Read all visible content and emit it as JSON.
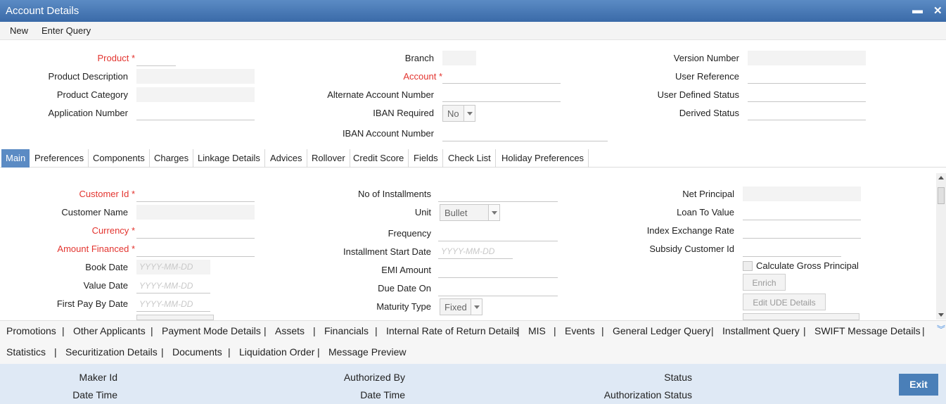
{
  "window": {
    "title": "Account Details",
    "minimize": "▬",
    "close": "✕"
  },
  "menu": {
    "new": "New",
    "enter_query": "Enter Query"
  },
  "header": {
    "product": "Product",
    "product_description": "Product Description",
    "product_category": "Product Category",
    "application_number": "Application Number",
    "branch": "Branch",
    "account": "Account",
    "alternate_account_number": "Alternate Account Number",
    "iban_required": "IBAN Required",
    "iban_required_value": "No",
    "iban_account_number": "IBAN Account Number",
    "version_number": "Version Number",
    "user_reference": "User Reference",
    "user_defined_status": "User Defined Status",
    "derived_status": "Derived Status"
  },
  "required_mark": "*",
  "tabs": [
    "Main",
    "Preferences",
    "Components",
    "Charges",
    "Linkage Details",
    "Advices",
    "Rollover",
    "Credit Score",
    "Fields",
    "Check List",
    "Holiday Preferences"
  ],
  "main": {
    "customer_id": "Customer Id",
    "customer_name": "Customer Name",
    "currency": "Currency",
    "amount_financed": "Amount Financed",
    "book_date": "Book Date",
    "value_date": "Value Date",
    "first_pay_by_date": "First Pay By Date",
    "date_placeholder": "YYYY-MM-DD",
    "no_of_installments": "No of Installments",
    "unit": "Unit",
    "unit_value": "Bullet",
    "frequency": "Frequency",
    "installment_start_date": "Installment Start Date",
    "emi_amount": "EMI Amount",
    "due_date_on": "Due Date On",
    "maturity_type": "Maturity Type",
    "maturity_type_value": "Fixed",
    "net_principal": "Net Principal",
    "loan_to_value": "Loan To Value",
    "index_exchange_rate": "Index Exchange Rate",
    "subsidy_customer_id": "Subsidy Customer Id",
    "calculate_gross_principal": "Calculate Gross Principal",
    "enrich": "Enrich",
    "edit_ude_details": "Edit UDE Details"
  },
  "subsystems": {
    "row1": [
      "Promotions",
      "Other Applicants",
      "Payment Mode Details",
      "Assets",
      "Financials",
      "Internal Rate of Return Details",
      "MIS",
      "Events",
      "General Ledger Query",
      "Installment Query",
      "SWIFT Message Details"
    ],
    "row2": [
      "Statistics",
      "Securitization Details",
      "Documents",
      "Liquidation Order",
      "Message Preview"
    ],
    "separator": "|",
    "expand_icon": "︾"
  },
  "footer": {
    "maker_id": "Maker Id",
    "date_time": "Date Time",
    "authorized_by": "Authorized By",
    "status": "Status",
    "authorization_status": "Authorization Status",
    "exit": "Exit"
  }
}
